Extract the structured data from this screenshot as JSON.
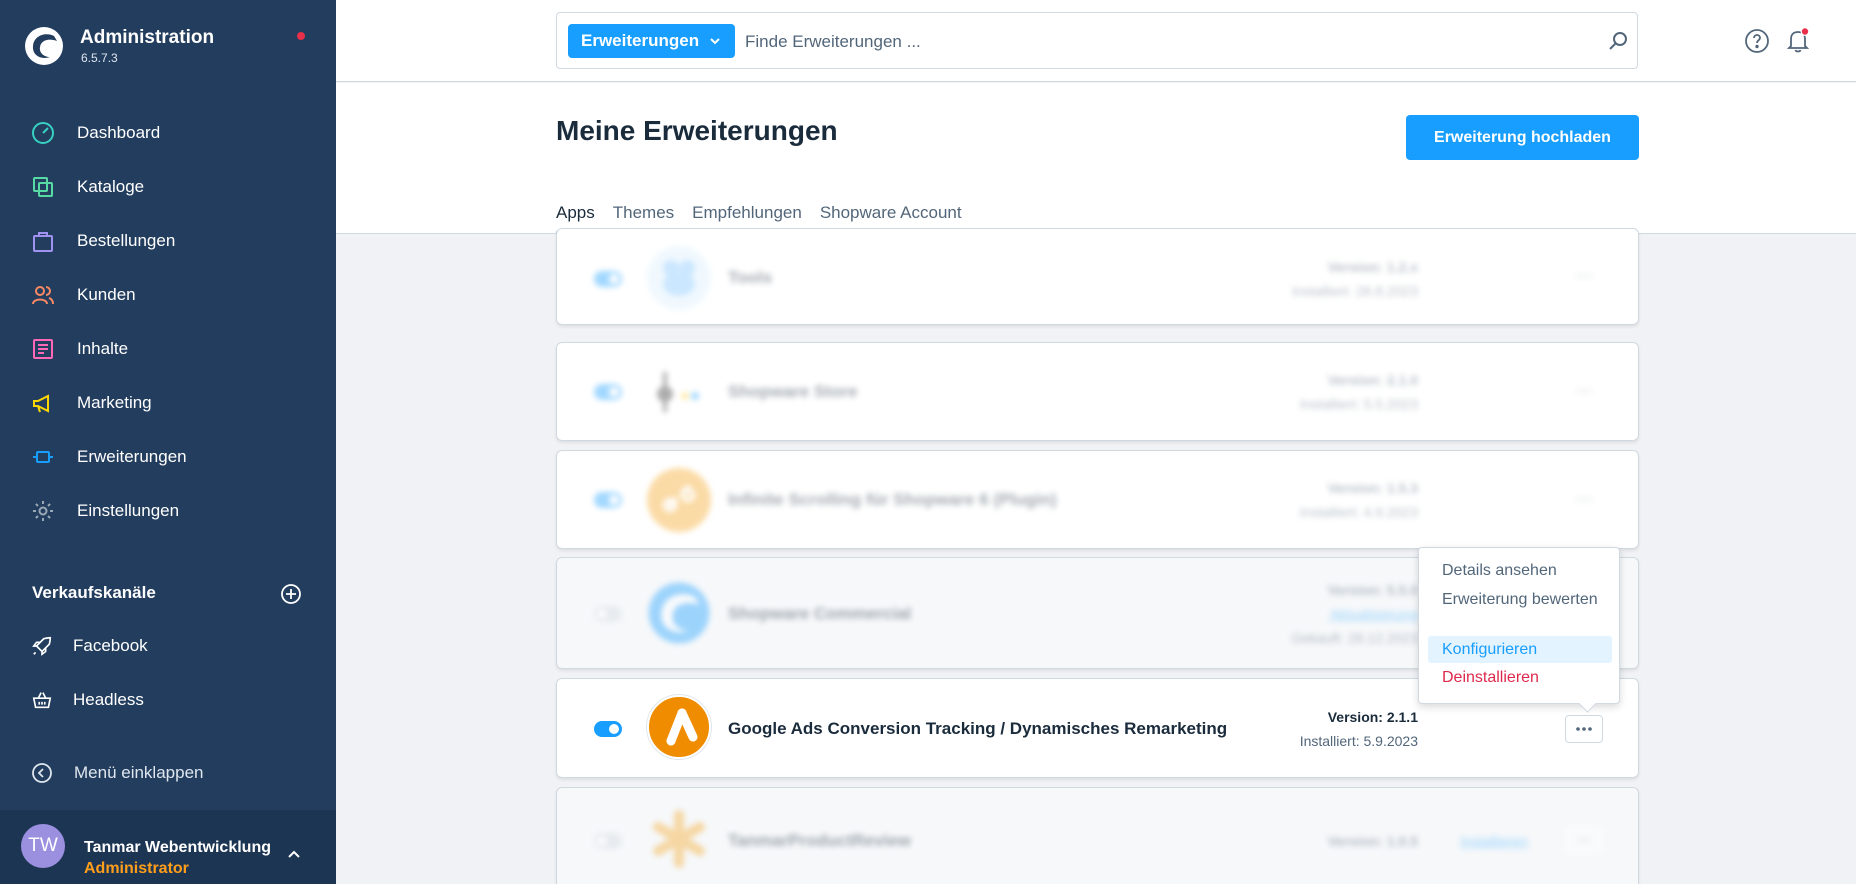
{
  "app": {
    "title": "Administration",
    "version": "6.5.7.3"
  },
  "nav": [
    {
      "label": "Dashboard",
      "icon": "dashboard-icon",
      "color": "#37d0c2"
    },
    {
      "label": "Kataloge",
      "icon": "catalog-icon",
      "color": "#57d9a3"
    },
    {
      "label": "Bestellungen",
      "icon": "orders-icon",
      "color": "#a092f0"
    },
    {
      "label": "Kunden",
      "icon": "customers-icon",
      "color": "#f88962"
    },
    {
      "label": "Inhalte",
      "icon": "content-icon",
      "color": "#ff68b4"
    },
    {
      "label": "Marketing",
      "icon": "marketing-icon",
      "color": "#ffd700"
    },
    {
      "label": "Erweiterungen",
      "icon": "extensions-icon",
      "color": "#189eff"
    },
    {
      "label": "Einstellungen",
      "icon": "settings-icon",
      "color": "#9aa8b5"
    }
  ],
  "sales_channels": {
    "title": "Verkaufskanäle",
    "items": [
      {
        "label": "Facebook",
        "icon": "rocket-icon"
      },
      {
        "label": "Headless",
        "icon": "basket-icon"
      }
    ]
  },
  "collapse_label": "Menü einklappen",
  "user": {
    "initials": "TW",
    "name": "Tanmar Webentwicklung",
    "role": "Administrator"
  },
  "search": {
    "type_label": "Erweiterungen",
    "placeholder": "Finde Erweiterungen ..."
  },
  "page": {
    "title": "Meine Erweiterungen",
    "upload_label": "Erweiterung hochladen",
    "tabs": [
      "Apps",
      "Themes",
      "Empfehlungen",
      "Shopware Account"
    ],
    "active_tab": "Apps"
  },
  "extensions": [
    {
      "name": "Tools",
      "version": "Version: 1.2.x",
      "installed": "Installiert: 28.8.2023",
      "blurred": true
    },
    {
      "name": "Shopware Store",
      "version": "Version: 2.1.0",
      "installed": "Installiert: 5.5.2023",
      "blurred": true
    },
    {
      "name": "Infinite Scrolling für Shopware 6 (Plugin)",
      "version": "Version: 1.5.3",
      "installed": "Installiert: 4.9.2023",
      "blurred": true
    },
    {
      "name": "Shopware Commercial",
      "version": "Version: 5.5.0",
      "link": "Aktualisierung",
      "installed": "Gekauft: 28.12.2023",
      "blurred": true
    },
    {
      "name": "Google Ads Conversion Tracking / Dynamisches Remarketing",
      "version": "Version: 2.1.1",
      "installed": "Installiert: 5.9.2023",
      "blurred": false
    },
    {
      "name": "TanmarProductReview",
      "version": "Version: 1.0.5",
      "link": "Installieren",
      "blurred": true
    }
  ],
  "context_menu": [
    "Details ansehen",
    "Erweiterung bewerten",
    "Konfigurieren",
    "Deinstallieren"
  ],
  "colors": {
    "sidebar": "#223d5e",
    "accent": "#189eff",
    "danger": "#de294c",
    "role": "#ff9e1b"
  }
}
